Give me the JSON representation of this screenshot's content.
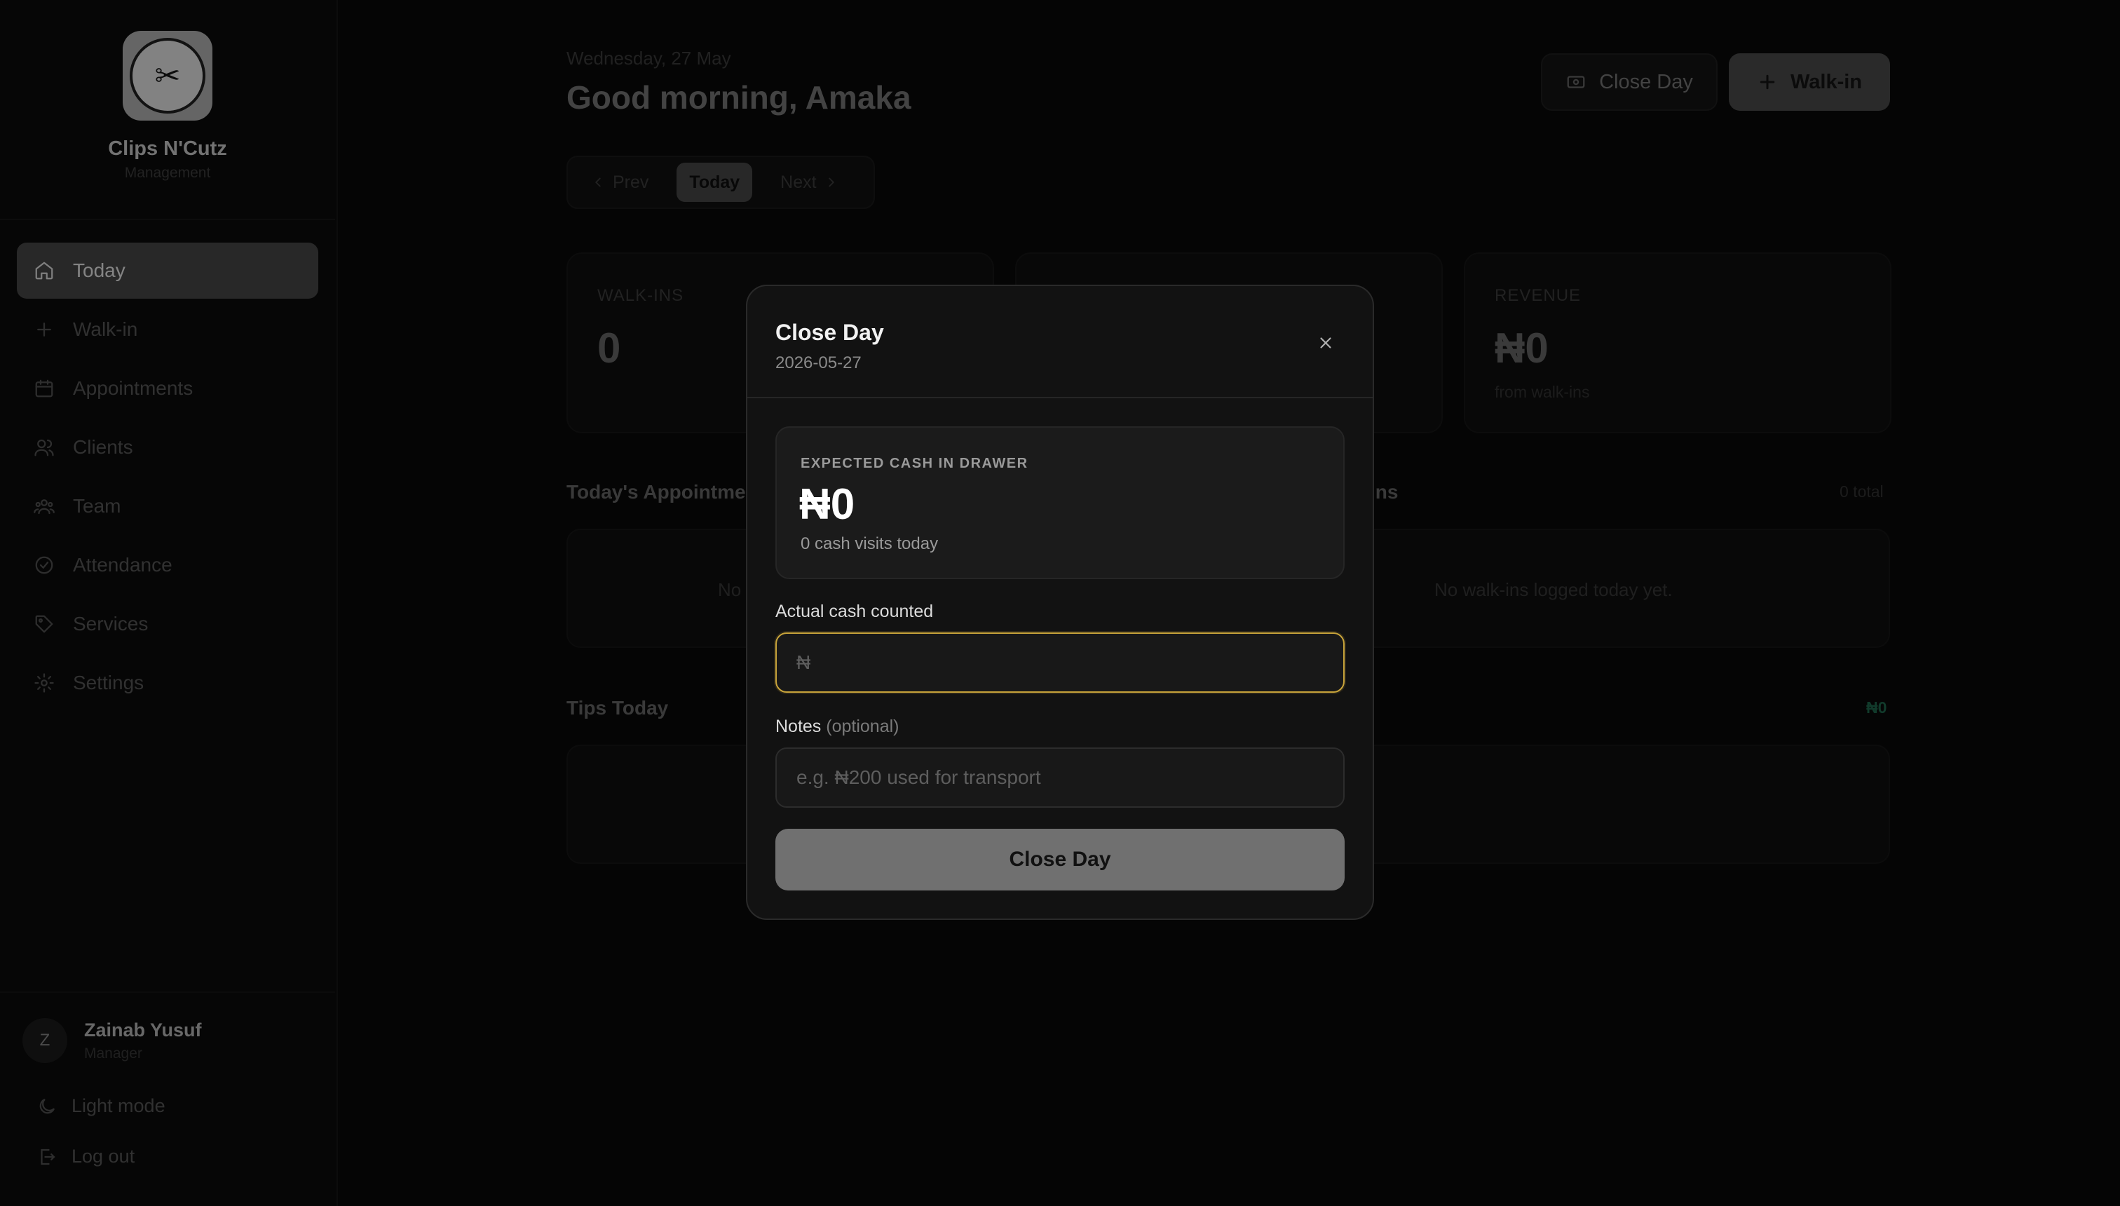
{
  "brand": {
    "name": "Clips N'Cutz",
    "subtitle": "Management"
  },
  "sidebar": {
    "items": [
      {
        "label": "Today",
        "icon": "home-icon",
        "active": true
      },
      {
        "label": "Walk-in",
        "icon": "plus-icon"
      },
      {
        "label": "Appointments",
        "icon": "calendar-icon"
      },
      {
        "label": "Clients",
        "icon": "users-icon"
      },
      {
        "label": "Team",
        "icon": "team-icon"
      },
      {
        "label": "Attendance",
        "icon": "check-circle-icon"
      },
      {
        "label": "Services",
        "icon": "tag-icon"
      },
      {
        "label": "Settings",
        "icon": "gear-icon"
      }
    ],
    "user": {
      "initial": "Z",
      "name": "Zainab Yusuf",
      "role": "Manager"
    },
    "light_mode_label": "Light mode",
    "logout_label": "Log out"
  },
  "header": {
    "date": "Wednesday, 27 May",
    "greeting": "Good morning, Amaka",
    "close_day_label": "Close Day",
    "walkin_label": "Walk-in"
  },
  "date_nav": {
    "prev": "Prev",
    "today": "Today",
    "next": "Next"
  },
  "stats": {
    "walkins": {
      "label": "WALK-INS",
      "value": "0"
    },
    "revenue": {
      "label": "REVENUE",
      "value": "₦0",
      "sub": "from walk-ins"
    }
  },
  "sections": {
    "appointments_title": "Today's Appointme",
    "appointments_empty": "No",
    "walkins_title_tail": "ins",
    "walkins_total": "0 total",
    "walkins_empty": "No walk-ins logged today yet.",
    "tips_title": "Tips Today",
    "tips_total": "₦0"
  },
  "modal": {
    "title": "Close Day",
    "date": "2026-05-27",
    "expected_label": "EXPECTED CASH IN DRAWER",
    "expected_value": "₦0",
    "expected_sub": "0 cash visits today",
    "cash_label": "Actual cash counted",
    "cash_placeholder": "₦",
    "notes_label": "Notes",
    "notes_optional": "(optional)",
    "notes_placeholder": "e.g. ₦200 used for transport",
    "submit_label": "Close Day"
  },
  "colors": {
    "accent_focus": "#c7a33a",
    "tips_green": "#1f6b4f"
  }
}
